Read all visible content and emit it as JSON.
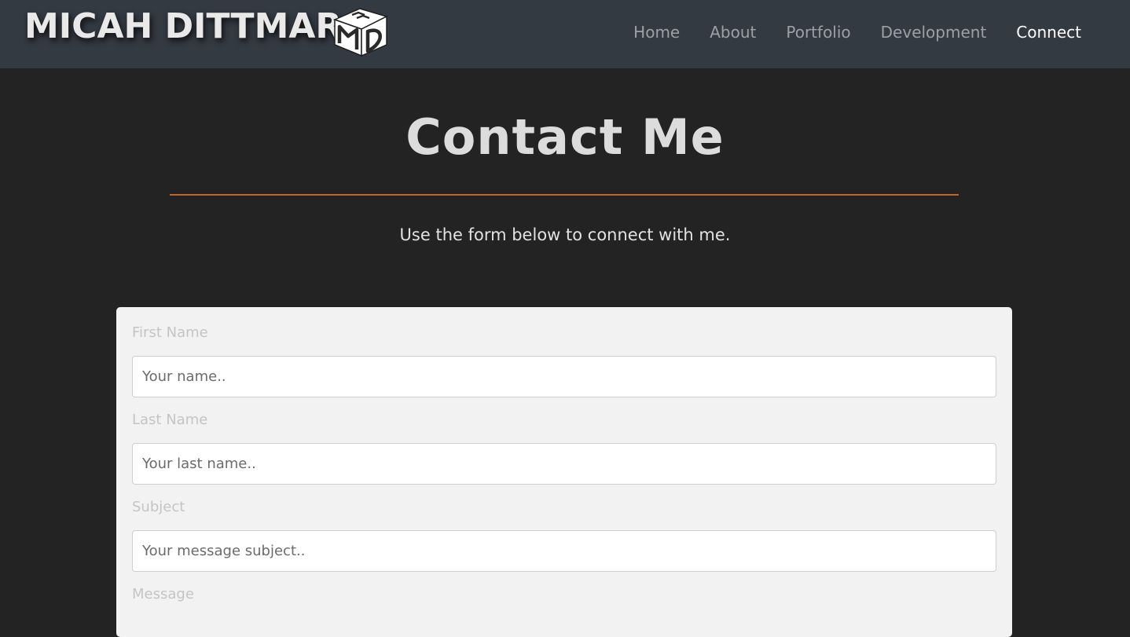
{
  "header": {
    "brand": "MICAH DITTMAR",
    "logo_text": "MD",
    "nav": [
      {
        "label": "Home",
        "active": false
      },
      {
        "label": "About",
        "active": false
      },
      {
        "label": "Portfolio",
        "active": false
      },
      {
        "label": "Development",
        "active": false
      },
      {
        "label": "Connect",
        "active": true
      }
    ]
  },
  "main": {
    "title": "Contact Me",
    "subtitle": "Use the form below to connect with me.",
    "accent_color": "#c8612a"
  },
  "form": {
    "first_name": {
      "label": "First Name",
      "placeholder": "Your name.."
    },
    "last_name": {
      "label": "Last Name",
      "placeholder": "Your last name.."
    },
    "subject": {
      "label": "Subject",
      "placeholder": "Your message subject.."
    },
    "message": {
      "label": "Message"
    }
  }
}
